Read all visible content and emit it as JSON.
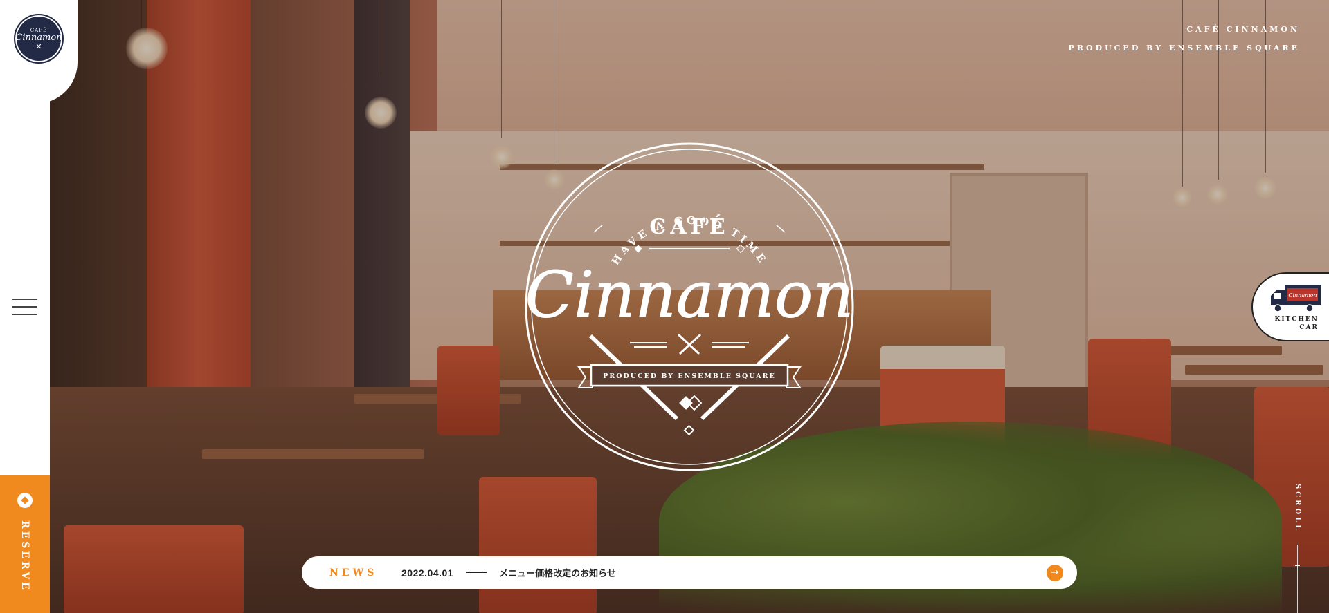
{
  "header": {
    "brand_line1": "CAFÉ CINNAMON",
    "brand_line2": "PRODUCED BY ENSEMBLE SQUARE"
  },
  "logo": {
    "cafe": "CAFÉ",
    "name": "Cinnamon",
    "icon": "fork-knife-icon"
  },
  "emblem": {
    "tagline": "HAVE A GOOD TIME",
    "cafe": "CAFÉ",
    "name": "Cinnamon",
    "ribbon": "PRODUCED BY ENSEMBLE SQUARE"
  },
  "sidebar": {
    "menu_icon": "hamburger-icon",
    "reserve_label": "RESERVE"
  },
  "kitchen_car": {
    "label_line1": "KITCHEN",
    "label_line2": "CAR",
    "truck_brand": "Cinnamon"
  },
  "scroll": {
    "label": "SCROLL"
  },
  "news": {
    "title": "NEWS",
    "date": "2022.04.01",
    "text": "メニュー価格改定のお知らせ",
    "arrow_icon": "arrow-right-icon"
  },
  "colors": {
    "accent": "#f0891e",
    "navy": "#232a45",
    "white": "#ffffff"
  }
}
